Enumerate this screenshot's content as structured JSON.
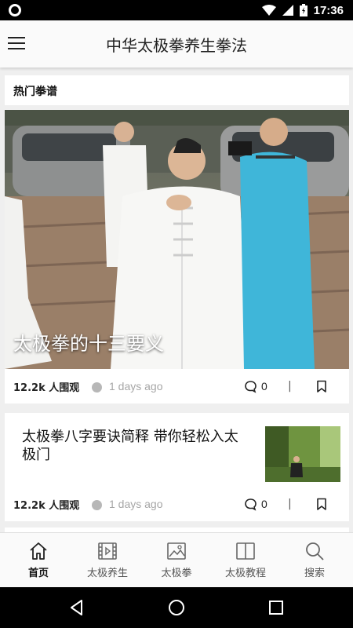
{
  "status_bar": {
    "time": "17:36"
  },
  "app": {
    "title": "中华太极拳养生拳法"
  },
  "section": {
    "title": "热门拳谱"
  },
  "featured": {
    "title": "太极拳的十三要义",
    "views": "12.2k 人围观",
    "time": "1 days ago",
    "comments": "0",
    "separator": "|"
  },
  "article2": {
    "title": "太极拳八字要诀简释 带你轻松入太极门",
    "views": "12.2k 人围观",
    "time": "1 days ago",
    "comments": "0",
    "separator": "|"
  },
  "tabs": [
    {
      "label": "首页",
      "icon": "home-icon",
      "active": true
    },
    {
      "label": "太极养生",
      "icon": "video-icon"
    },
    {
      "label": "太极拳",
      "icon": "image-icon"
    },
    {
      "label": "太极教程",
      "icon": "book-icon"
    },
    {
      "label": "搜索",
      "icon": "search-icon"
    }
  ],
  "colors": {
    "accent_active": "#111111",
    "tab_inactive": "#555555",
    "meta_gray": "#a6a6a6"
  }
}
